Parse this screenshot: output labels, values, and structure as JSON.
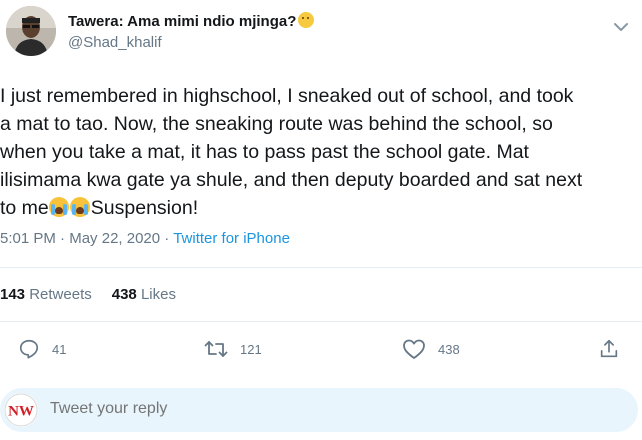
{
  "author": {
    "display_name": "Tawera: Ama mimi ndio mjinga?",
    "handle": "@Shad_khalif"
  },
  "tweet": {
    "lines": [
      "I just remembered in highschool, I sneaked out of school, and took",
      "a mat to tao. Now, the sneaking route was behind the school, so",
      "when you take a mat, it has to pass past the school gate. Mat",
      "ilisimama kwa gate ya shule, and then deputy boarded and sat next"
    ],
    "last_line_prefix": "to me",
    "last_line_suffix": "Suspension!"
  },
  "meta": {
    "time": "5:01 PM",
    "separator": "·",
    "date": "May 22, 2020",
    "source": "Twitter for iPhone"
  },
  "stats": {
    "retweets_count": "143",
    "retweets_label": "Retweets",
    "likes_count": "438",
    "likes_label": "Likes"
  },
  "actions": {
    "reply_count": "41",
    "retweet_count": "121",
    "like_count": "438"
  },
  "reply": {
    "placeholder": "Tweet your reply",
    "avatar_text": "NW"
  },
  "colors": {
    "accent": "#1b95e0",
    "secondary_text": "#657786",
    "reply_bg": "#e8f5fd"
  }
}
